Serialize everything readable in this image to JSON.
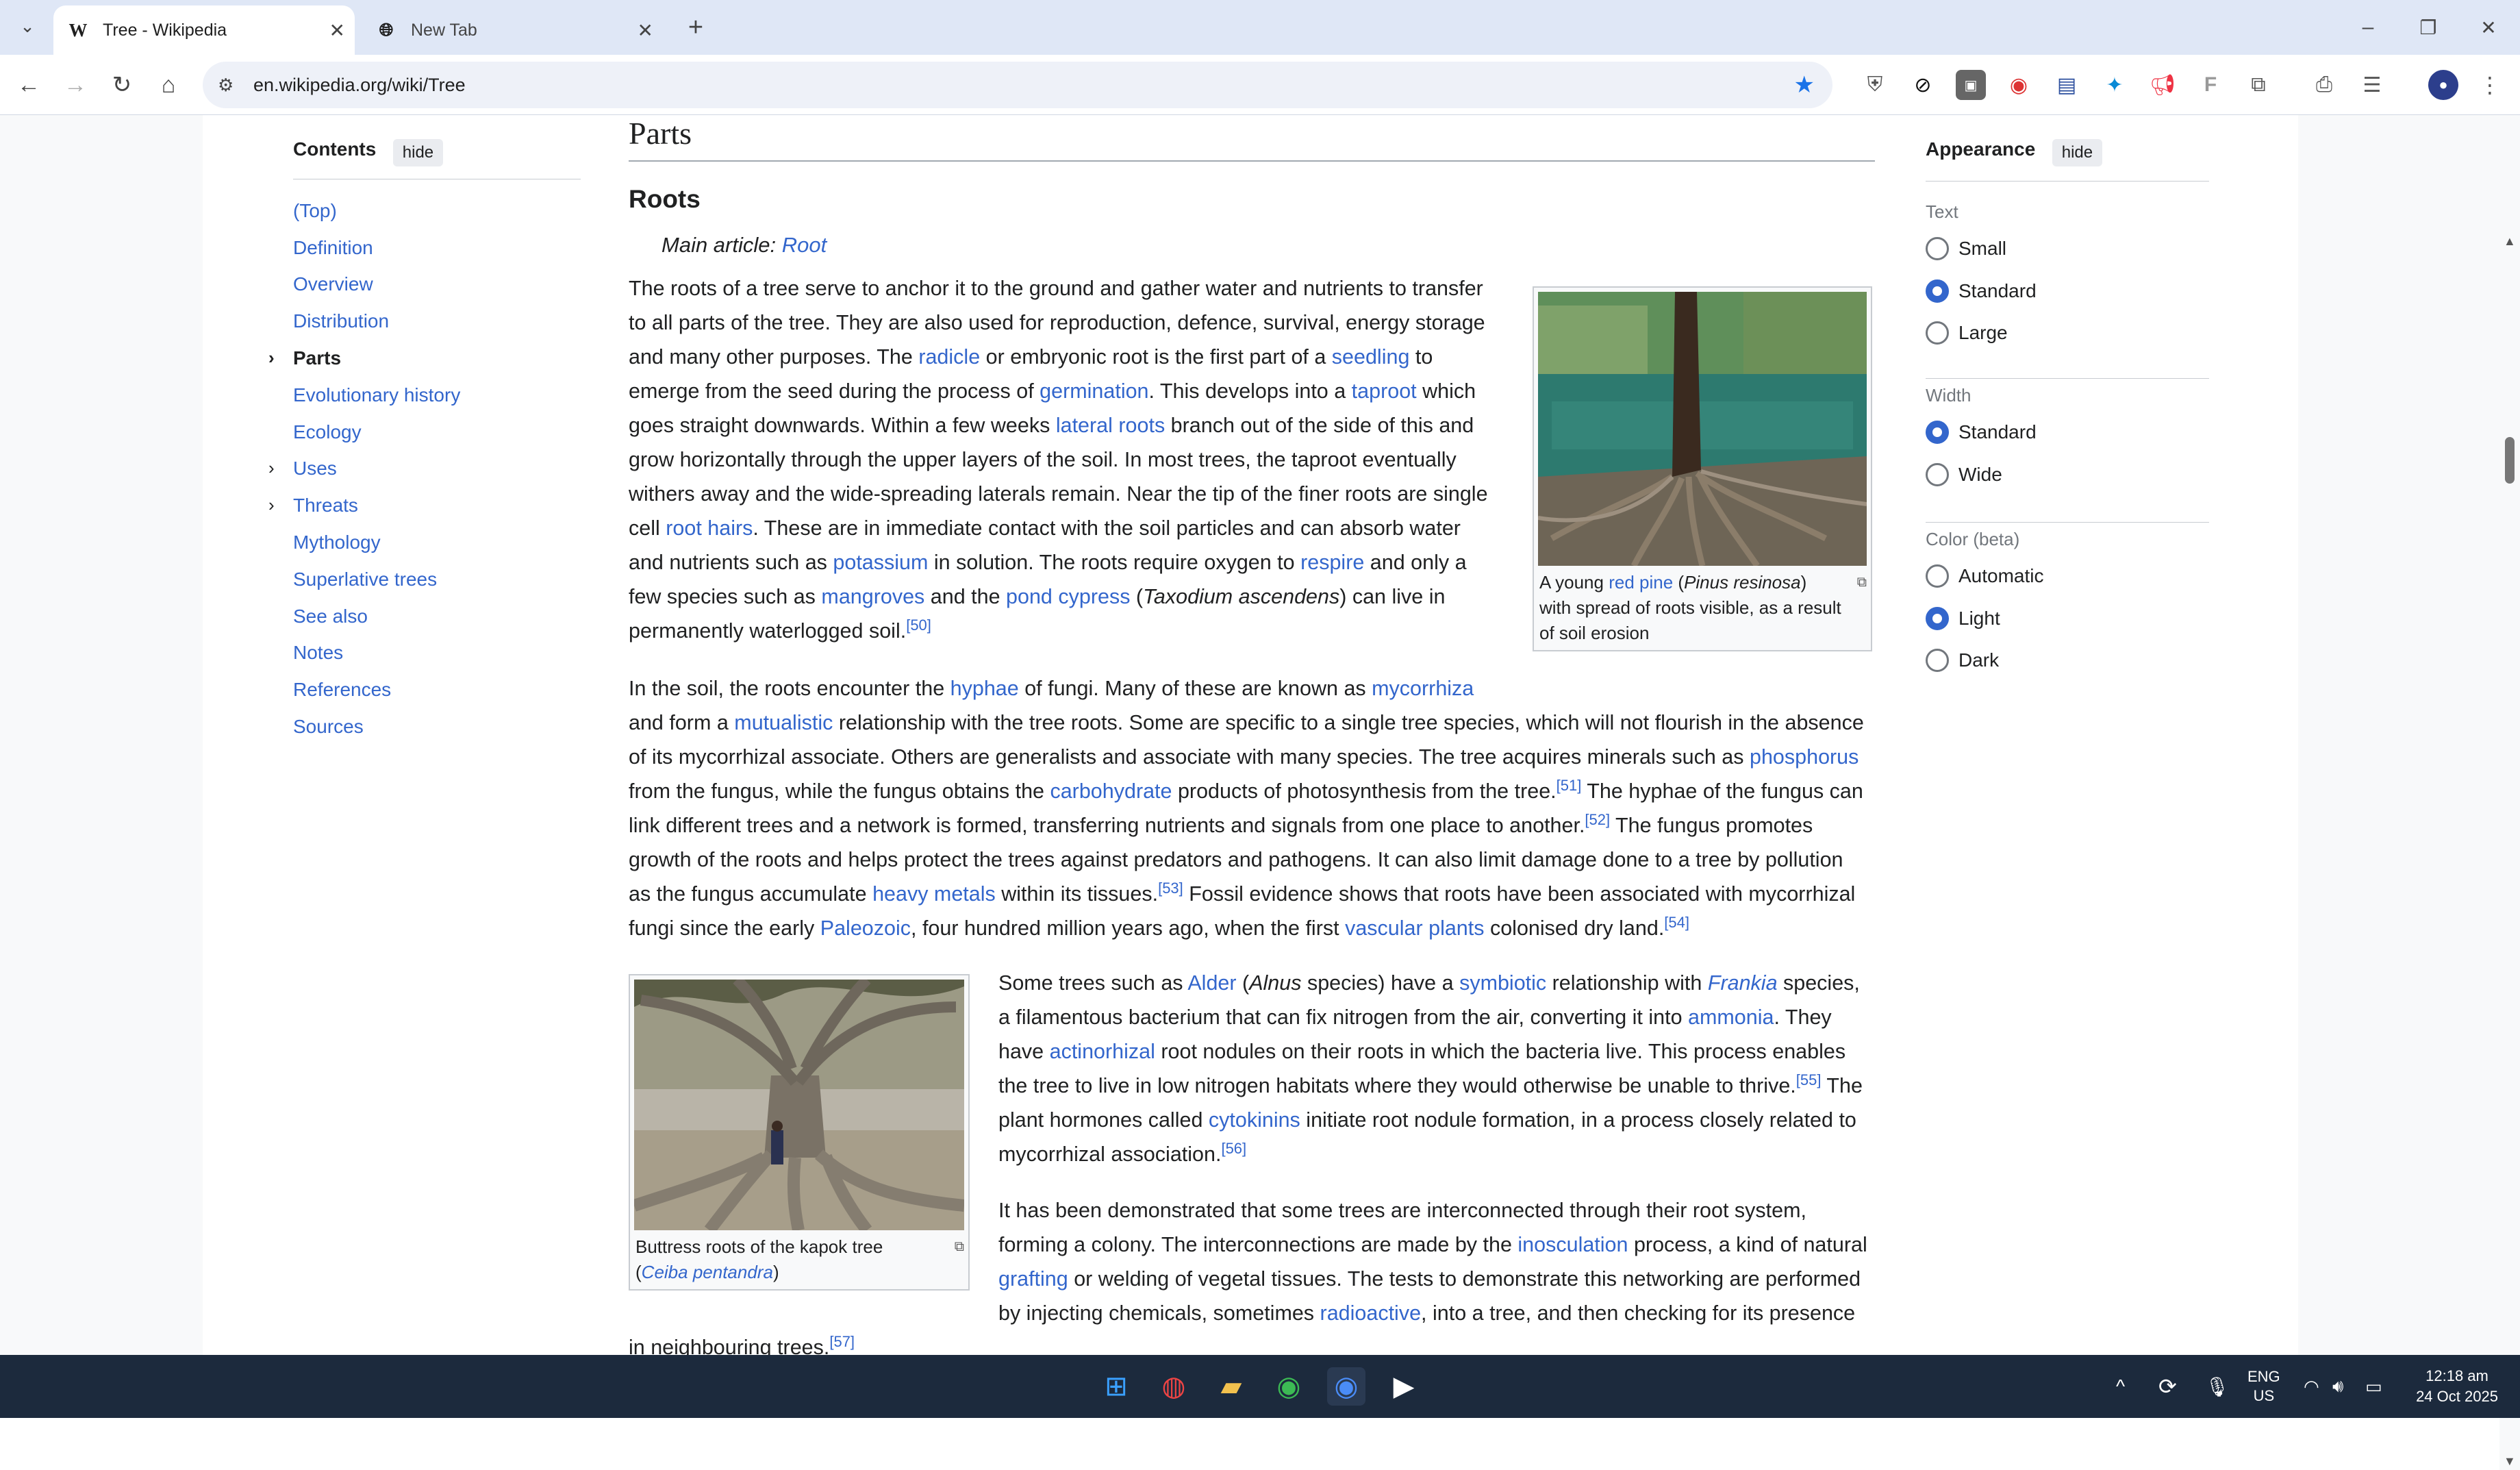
{
  "browser": {
    "tabs": [
      {
        "title": "Tree - Wikipedia",
        "icon": "W",
        "active": true
      },
      {
        "title": "New Tab",
        "icon": "globe",
        "active": false
      }
    ],
    "url": "en.wikipedia.org/wiki/Tree"
  },
  "toc": {
    "title": "Contents",
    "hide_label": "hide",
    "items": [
      {
        "label": "(Top)"
      },
      {
        "label": "Definition"
      },
      {
        "label": "Overview"
      },
      {
        "label": "Distribution"
      },
      {
        "label": "Parts",
        "current": true,
        "expandable": true
      },
      {
        "label": "Evolutionary history"
      },
      {
        "label": "Ecology"
      },
      {
        "label": "Uses",
        "expandable": true
      },
      {
        "label": "Threats",
        "expandable": true
      },
      {
        "label": "Mythology"
      },
      {
        "label": "Superlative trees"
      },
      {
        "label": "See also"
      },
      {
        "label": "Notes"
      },
      {
        "label": "References"
      },
      {
        "label": "Sources"
      }
    ]
  },
  "article": {
    "section_title": "Parts",
    "subsection_title": "Roots",
    "hatnote_prefix": "Main article: ",
    "hatnote_link": "Root",
    "figure1_caption": [
      "A young ",
      "red pine",
      " (",
      "Pinus resinosa",
      ")",
      "with spread of roots visible, as a result",
      "of soil erosion"
    ],
    "figure2_caption": [
      "Buttress roots of the kapok tree",
      "(",
      "Ceiba pentandra",
      ")"
    ],
    "para1": [
      [
        [
          "The roots of a tree serve to anchor it to the ground and gather water and nutrients to transfer",
          ""
        ]
      ],
      [
        [
          "to all parts of the tree. They are also used for reproduction, defence, survival, energy storage",
          ""
        ]
      ],
      [
        [
          "and many other purposes. The ",
          ""
        ],
        [
          "radicle",
          "a"
        ],
        [
          " or embryonic root is the first part of a ",
          ""
        ],
        [
          "seedling",
          "a"
        ],
        [
          " to",
          ""
        ]
      ],
      [
        [
          "emerge from the seed during the process of ",
          ""
        ],
        [
          "germination",
          "a"
        ],
        [
          ". This develops into a ",
          ""
        ],
        [
          "taproot",
          "a"
        ],
        [
          " which",
          ""
        ]
      ],
      [
        [
          "goes straight downwards. Within a few weeks ",
          ""
        ],
        [
          "lateral roots",
          "a"
        ],
        [
          " branch out of the side of this and",
          ""
        ]
      ],
      [
        [
          "grow horizontally through the upper layers of the soil. In most trees, the taproot eventually",
          ""
        ]
      ],
      [
        [
          "withers away and the wide-spreading laterals remain. Near the tip of the finer roots are single",
          ""
        ]
      ],
      [
        [
          "cell ",
          ""
        ],
        [
          "root hairs",
          "a"
        ],
        [
          ". These are in immediate contact with the soil particles and can absorb water",
          ""
        ]
      ],
      [
        [
          "and nutrients such as ",
          ""
        ],
        [
          "potassium",
          "a"
        ],
        [
          " in solution. The roots require oxygen to ",
          ""
        ],
        [
          "respire",
          "a"
        ],
        [
          " and only a",
          ""
        ]
      ],
      [
        [
          "few species such as ",
          ""
        ],
        [
          "mangroves",
          "a"
        ],
        [
          " and the ",
          ""
        ],
        [
          "pond cypress",
          "a"
        ],
        [
          " (",
          ""
        ],
        [
          "Taxodium ascendens",
          "i"
        ],
        [
          ") can live in",
          ""
        ]
      ],
      [
        [
          "permanently waterlogged soil.",
          ""
        ],
        [
          "[50]",
          "s"
        ]
      ]
    ],
    "para2": [
      [
        [
          "In the soil, the roots encounter the ",
          ""
        ],
        [
          "hyphae",
          "a"
        ],
        [
          " of fungi. Many of these are known as ",
          ""
        ],
        [
          "mycorrhiza",
          "a"
        ]
      ],
      [
        [
          "and form a ",
          ""
        ],
        [
          "mutualistic",
          "a"
        ],
        [
          " relationship with the tree roots. Some are specific to a single tree species, which will not flourish in the absence",
          ""
        ]
      ],
      [
        [
          "of its mycorrhizal associate. Others are generalists and associate with many species. The tree acquires minerals such as ",
          ""
        ],
        [
          "phosphorus",
          "a"
        ]
      ],
      [
        [
          "from the fungus, while the fungus obtains the ",
          ""
        ],
        [
          "carbohydrate",
          "a"
        ],
        [
          " products of photosynthesis from the tree.",
          ""
        ],
        [
          "[51]",
          "s"
        ],
        [
          " The hyphae of the fungus can",
          ""
        ]
      ],
      [
        [
          "link different trees and a network is formed, transferring nutrients and signals from one place to another.",
          ""
        ],
        [
          "[52]",
          "s"
        ],
        [
          " The fungus promotes",
          ""
        ]
      ],
      [
        [
          "growth of the roots and helps protect the trees against predators and pathogens. It can also limit damage done to a tree by pollution",
          ""
        ]
      ],
      [
        [
          "as the fungus accumulate ",
          ""
        ],
        [
          "heavy metals",
          "a"
        ],
        [
          " within its tissues.",
          ""
        ],
        [
          "[53]",
          "s"
        ],
        [
          " Fossil evidence shows that roots have been associated with mycorrhizal",
          ""
        ]
      ],
      [
        [
          "fungi since the early ",
          ""
        ],
        [
          "Paleozoic",
          "a"
        ],
        [
          ", four hundred million years ago, when the first ",
          ""
        ],
        [
          "vascular plants",
          "a"
        ],
        [
          " colonised dry land.",
          ""
        ],
        [
          "[54]",
          "s"
        ]
      ]
    ],
    "para3": [
      [
        [
          "Some trees such as ",
          ""
        ],
        [
          "Alder",
          "a"
        ],
        [
          " (",
          ""
        ],
        [
          "Alnus",
          "i"
        ],
        [
          " species) have a ",
          ""
        ],
        [
          "symbiotic",
          "a"
        ],
        [
          " relationship with ",
          ""
        ],
        [
          "Frankia",
          "ai"
        ],
        [
          " species,",
          ""
        ]
      ],
      [
        [
          "a filamentous bacterium that can fix nitrogen from the air, converting it into ",
          ""
        ],
        [
          "ammonia",
          "a"
        ],
        [
          ". They",
          ""
        ]
      ],
      [
        [
          "have ",
          ""
        ],
        [
          "actinorhizal",
          "a"
        ],
        [
          " root nodules on their roots in which the bacteria live. This process enables",
          ""
        ]
      ],
      [
        [
          "the tree to live in low nitrogen habitats where they would otherwise be unable to thrive.",
          ""
        ],
        [
          "[55]",
          "s"
        ],
        [
          " The",
          ""
        ]
      ],
      [
        [
          "plant hormones called ",
          ""
        ],
        [
          "cytokinins",
          "a"
        ],
        [
          " initiate root nodule formation, in a process closely related to",
          ""
        ]
      ],
      [
        [
          "mycorrhizal association.",
          ""
        ],
        [
          "[56]",
          "s"
        ]
      ]
    ],
    "para4": [
      [
        [
          "It has been demonstrated that some trees are interconnected through their root system,",
          ""
        ]
      ],
      [
        [
          "forming a colony. The interconnections are made by the ",
          ""
        ],
        [
          "inosculation",
          "a"
        ],
        [
          " process, a kind of natural",
          ""
        ]
      ],
      [
        [
          "grafting",
          "a"
        ],
        [
          " or welding of vegetal tissues. The tests to demonstrate this networking are performed",
          ""
        ]
      ],
      [
        [
          "by injecting chemicals, sometimes ",
          ""
        ],
        [
          "radioactive",
          "a"
        ],
        [
          ", into a tree, and then checking for its presence",
          ""
        ]
      ]
    ],
    "para4_last": [
      [
        "in neighbouring trees.",
        ""
      ],
      [
        "[57]",
        "s"
      ]
    ]
  },
  "appearance": {
    "title": "Appearance",
    "hide_label": "hide",
    "text_label": "Text",
    "text_options": [
      {
        "label": "Small",
        "checked": false
      },
      {
        "label": "Standard",
        "checked": true
      },
      {
        "label": "Large",
        "checked": false
      }
    ],
    "width_label": "Width",
    "width_options": [
      {
        "label": "Standard",
        "checked": true
      },
      {
        "label": "Wide",
        "checked": false
      }
    ],
    "color_label": "Color (beta)",
    "color_options": [
      {
        "label": "Automatic",
        "checked": false
      },
      {
        "label": "Light",
        "checked": true
      },
      {
        "label": "Dark",
        "checked": false
      }
    ]
  },
  "taskbar": {
    "lang": "ENG",
    "region": "US",
    "time": "12:18 am",
    "date": "24 Oct 2025"
  },
  "colors": {
    "link": "#3366cc",
    "text": "#202122",
    "taskbar": "#1c2a3d",
    "tabbar": "#dfe7f6"
  }
}
